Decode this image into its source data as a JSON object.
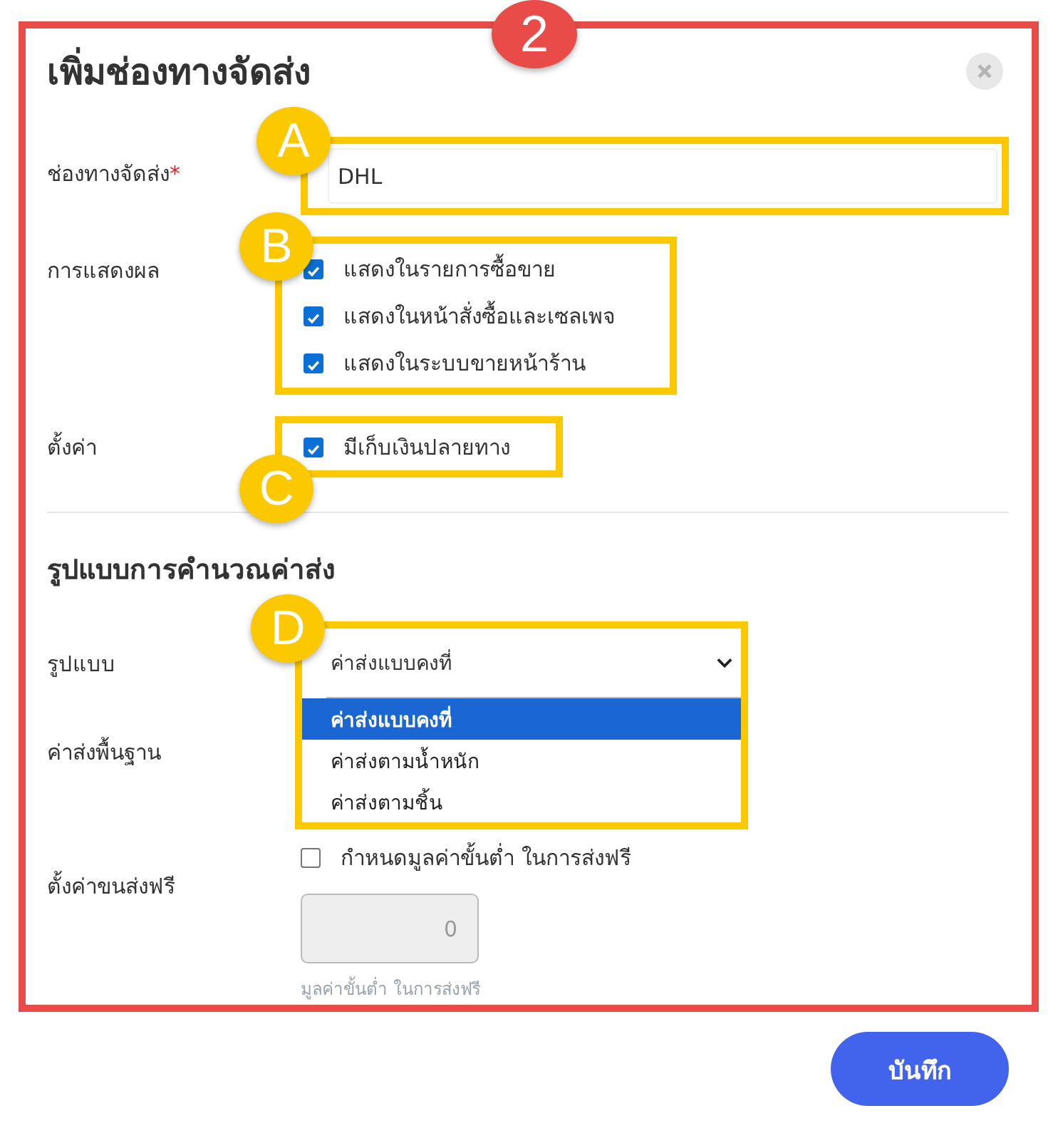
{
  "frame_badge": "2",
  "title": "เพิ่มช่องทางจัดส่ง",
  "channel": {
    "label": "ช่องทางจัดส่ง",
    "required_mark": "*",
    "value": "DHL",
    "marker": "A"
  },
  "display": {
    "label": "การแสดงผล",
    "marker": "B",
    "options": [
      {
        "label": "แสดงในรายการซื้อขาย",
        "checked": true
      },
      {
        "label": "แสดงในหน้าสั่งซื้อและเซลเพจ",
        "checked": true
      },
      {
        "label": "แสดงในระบบขายหน้าร้าน",
        "checked": true
      }
    ]
  },
  "settings": {
    "label": "ตั้งค่า",
    "marker": "C",
    "options": [
      {
        "label": "มีเก็บเงินปลายทาง",
        "checked": true
      }
    ]
  },
  "section_title": "รูปแบบการคำนวณค่าส่ง",
  "format": {
    "label": "รูปแบบ",
    "marker": "D",
    "value": "ค่าส่งแบบคงที่",
    "options": [
      {
        "label": "ค่าส่งแบบคงที่",
        "selected": true
      },
      {
        "label": "ค่าส่งตามน้ำหนัก",
        "selected": false
      },
      {
        "label": "ค่าส่งตามชิ้น",
        "selected": false
      }
    ]
  },
  "base_fee": {
    "label": "ค่าส่งพื้นฐาน"
  },
  "free_shipping": {
    "label": "ตั้งค่าขนส่งฟรี",
    "option": {
      "label": "กำหนดมูลค่าขั้นต่ำ ในการส่งฟรี",
      "checked": false
    },
    "minimum": {
      "value": "0",
      "disabled": true,
      "hint": "มูลค่าขั้นต่ำ ในการส่งฟรี"
    }
  },
  "save_button": "บันทึก"
}
